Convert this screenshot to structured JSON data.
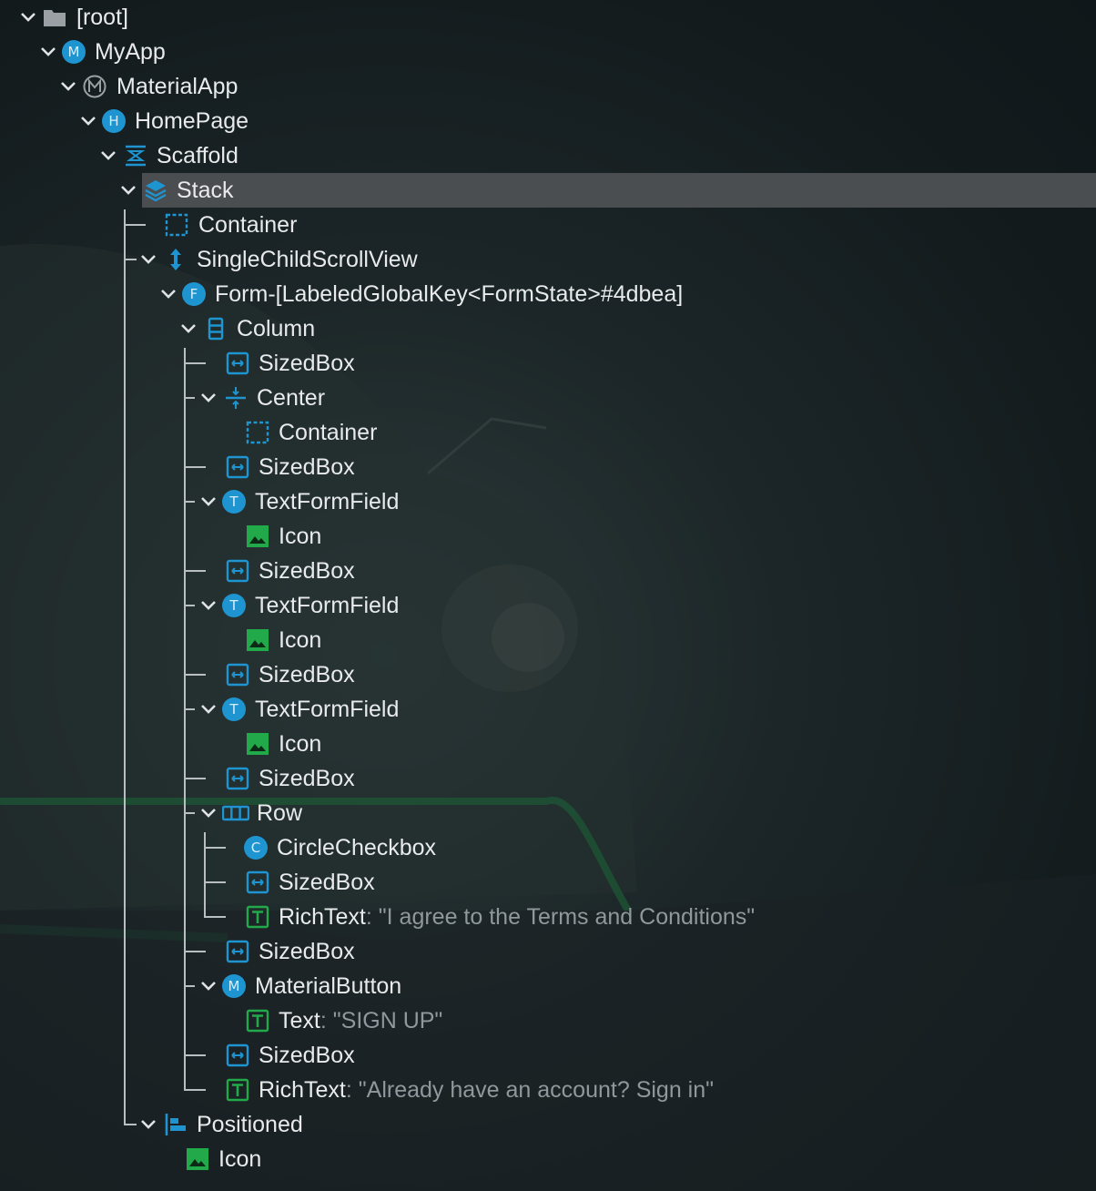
{
  "tree": {
    "nodes": [
      {
        "label": "[root]"
      },
      {
        "label": "MyApp",
        "badge": "M"
      },
      {
        "label": "MaterialApp"
      },
      {
        "label": "HomePage",
        "badge": "H"
      },
      {
        "label": "Scaffold"
      },
      {
        "label": "Stack",
        "selected": true
      },
      {
        "label": "Container"
      },
      {
        "label": "SingleChildScrollView"
      },
      {
        "label": "Form-[LabeledGlobalKey<FormState>#4dbea]",
        "badge": "F"
      },
      {
        "label": "Column"
      },
      {
        "label": "SizedBox"
      },
      {
        "label": "Center"
      },
      {
        "label": "Container"
      },
      {
        "label": "SizedBox"
      },
      {
        "label": "TextFormField",
        "badge": "T"
      },
      {
        "label": "Icon"
      },
      {
        "label": "SizedBox"
      },
      {
        "label": "TextFormField",
        "badge": "T"
      },
      {
        "label": "Icon"
      },
      {
        "label": "SizedBox"
      },
      {
        "label": "TextFormField",
        "badge": "T"
      },
      {
        "label": "Icon"
      },
      {
        "label": "SizedBox"
      },
      {
        "label": "Row"
      },
      {
        "label": "CircleCheckbox",
        "badge": "C"
      },
      {
        "label": "SizedBox"
      },
      {
        "label": "RichText",
        "value": "\"I agree to the Terms and Conditions\""
      },
      {
        "label": "SizedBox"
      },
      {
        "label": "MaterialButton",
        "badge": "M"
      },
      {
        "label": "Text",
        "value": "\"SIGN UP\""
      },
      {
        "label": "SizedBox"
      },
      {
        "label": "RichText",
        "value": "\"Already have an account? Sign in\""
      },
      {
        "label": "Positioned"
      },
      {
        "label": "Icon"
      }
    ],
    "separator": ":"
  },
  "colors": {
    "accent_blue": "#1e94d0",
    "icon_green": "#22a94a",
    "selection": "#4a4e50",
    "text": "#e8eaec",
    "value_text": "#8f989c"
  }
}
